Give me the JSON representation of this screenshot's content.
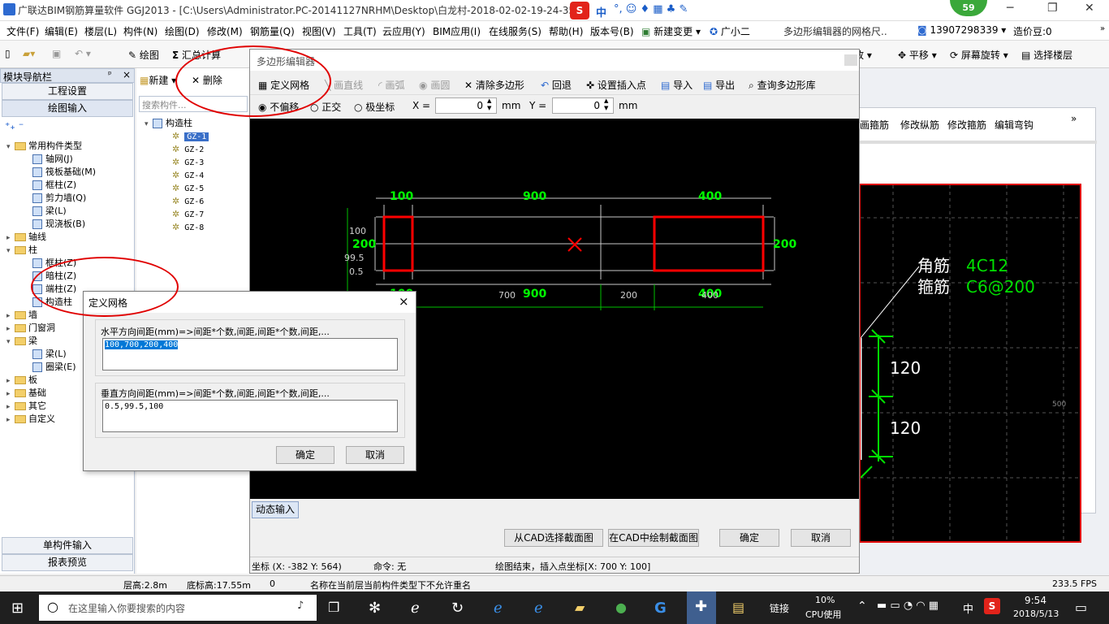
{
  "titlebar": {
    "text": "广联达BIM钢筋算量软件 GGJ2013 - [C:\\Users\\Administrator.PC-20141127NRHM\\Desktop\\白龙村-2018-02-02-19-24-35",
    "ime_label": "中",
    "badge": "59"
  },
  "menu": [
    "文件(F)",
    "编辑(E)",
    "楼层(L)",
    "构件(N)",
    "绘图(D)",
    "修改(M)",
    "钢筋量(Q)",
    "视图(V)",
    "工具(T)",
    "云应用(Y)",
    "BIM应用(I)",
    "在线服务(S)",
    "帮助(H)",
    "版本号(B)",
    "新建变更",
    "广小二"
  ],
  "menu_right": {
    "hint": "多边形编辑器的网格尺..",
    "phone": "13907298339",
    "price": "造价豆:0"
  },
  "toolbar": {
    "draw": "绘图",
    "sum": "汇总计算",
    "zoom": "缩放",
    "pan": "平移",
    "rotate": "屏幕旋转",
    "select_floor": "选择楼层"
  },
  "nav": {
    "title": "模块导航栏",
    "pin": "ᵖ",
    "close": "×",
    "btn_project": "工程设置",
    "btn_draw": "绘图输入",
    "tree": [
      {
        "label": "常用构件类型",
        "indent": 0,
        "type": "folder",
        "open": true
      },
      {
        "label": "轴网(J)",
        "indent": 1,
        "type": "item"
      },
      {
        "label": "筏板基础(M)",
        "indent": 1,
        "type": "item"
      },
      {
        "label": "框柱(Z)",
        "indent": 1,
        "type": "item"
      },
      {
        "label": "剪力墙(Q)",
        "indent": 1,
        "type": "item"
      },
      {
        "label": "梁(L)",
        "indent": 1,
        "type": "item"
      },
      {
        "label": "现浇板(B)",
        "indent": 1,
        "type": "item"
      },
      {
        "label": "轴线",
        "indent": 0,
        "type": "folder",
        "open": false
      },
      {
        "label": "柱",
        "indent": 0,
        "type": "folder",
        "open": true
      },
      {
        "label": "框柱(Z)",
        "indent": 1,
        "type": "item"
      },
      {
        "label": "暗柱(Z)",
        "indent": 1,
        "type": "item"
      },
      {
        "label": "端柱(Z)",
        "indent": 1,
        "type": "item"
      },
      {
        "label": "构造柱",
        "indent": 1,
        "type": "item"
      },
      {
        "label": "墙",
        "indent": 0,
        "type": "folder",
        "open": false
      },
      {
        "label": "门窗洞",
        "indent": 0,
        "type": "folder",
        "open": false
      },
      {
        "label": "梁",
        "indent": 0,
        "type": "folder",
        "open": true
      },
      {
        "label": "梁(L)",
        "indent": 1,
        "type": "item"
      },
      {
        "label": "圈梁(E)",
        "indent": 1,
        "type": "item"
      },
      {
        "label": "板",
        "indent": 0,
        "type": "folder",
        "open": false
      },
      {
        "label": "基础",
        "indent": 0,
        "type": "folder",
        "open": false
      },
      {
        "label": "其它",
        "indent": 0,
        "type": "folder",
        "open": false
      },
      {
        "label": "自定义",
        "indent": 0,
        "type": "folder",
        "open": false
      }
    ],
    "btn_single": "单构件输入",
    "btn_report": "报表预览"
  },
  "components": {
    "new": "新建",
    "delete": "删除",
    "search_placeholder": "搜索构件...",
    "root": "构造柱",
    "items": [
      "GZ-1",
      "GZ-2",
      "GZ-3",
      "GZ-4",
      "GZ-5",
      "GZ-6",
      "GZ-7",
      "GZ-8"
    ]
  },
  "poly_editor": {
    "title": "多边形编辑器",
    "toolbar": [
      "定义网格",
      "画直线",
      "画弧",
      "画圆",
      "清除多边形",
      "回退",
      "设置插入点",
      "导入",
      "导出",
      "查询多边形库"
    ],
    "mode_none": "不偏移",
    "mode_ortho": "正交",
    "mode_polar": "极坐标",
    "x_label": "X =",
    "x_value": "0",
    "y_label": "Y =",
    "y_value": "0",
    "unit": "mm",
    "dim_top": [
      "100",
      "900",
      "400"
    ],
    "dim_bottom": [
      "100",
      "900",
      "400"
    ],
    "dim_grid_bottom": [
      "700",
      "200",
      "400"
    ],
    "dim_left": [
      "100",
      "99.5",
      "0.5"
    ],
    "dim_left_big": "200",
    "dim_right": "200",
    "dynamic_input": "动态输入",
    "btn_cad_select": "从CAD选择截面图",
    "btn_cad_draw": "在CAD中绘制截面图",
    "btn_ok": "确定",
    "btn_cancel": "取消",
    "coord": "坐标 (X: -382 Y: 564)",
    "command": "命令: 无",
    "prompt": "绘图结束，插入点坐标[X: 700 Y: 100]"
  },
  "grid_dialog": {
    "title": "定义网格",
    "close": "×",
    "h_label": "水平方向间距(mm)=>间距*个数,间距,间距*个数,间距,...",
    "h_value": "100,700,200,400",
    "v_label": "垂直方向间距(mm)=>间距*个数,间距,间距*个数,间距,...",
    "v_value": "0.5,99.5,100",
    "ok": "确定",
    "cancel": "取消"
  },
  "right_panel": {
    "tools": [
      "画箍筋",
      "修改纵筋",
      "修改箍筋",
      "编辑弯钩"
    ],
    "corner_bar": "角筋",
    "corner_val": "4C12",
    "stirrup": "箍筋",
    "stirrup_val": "C6@200",
    "dim1": "120",
    "dim2": "120",
    "side": "500"
  },
  "status": {
    "floor": "层高:2.8m",
    "base": "底标高:17.55m",
    "zero": "0",
    "msg": "名称在当前层当前构件类型下不允许重名",
    "fps": "233.5 FPS"
  },
  "taskbar": {
    "search": "在这里输入你要搜索的内容",
    "link": "链接",
    "cpu_pct": "10%",
    "cpu_label": "CPU使用",
    "ime": "中",
    "time": "9:54",
    "date": "2018/5/13"
  },
  "colors": {
    "accent": "#2e6ad0",
    "dim_green": "#00ff00",
    "poly_red": "#ff0000",
    "annot_red": "#e00000"
  }
}
